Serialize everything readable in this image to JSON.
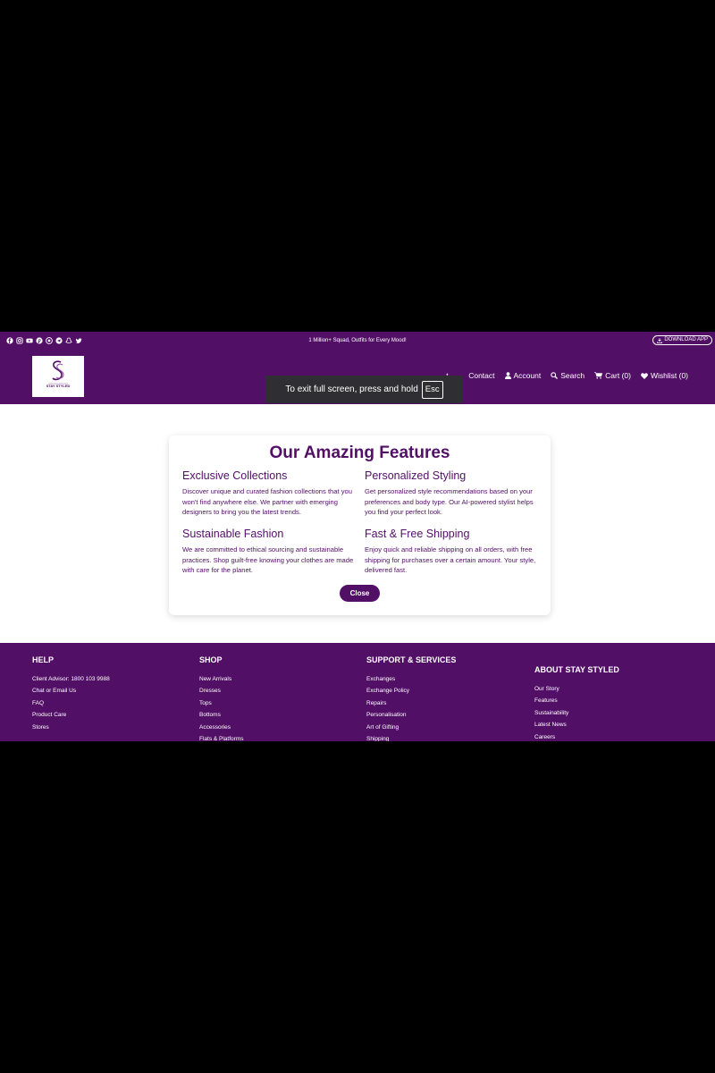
{
  "topbar": {
    "social_icons": [
      "facebook-icon",
      "instagram-icon",
      "youtube-icon",
      "pinterest-icon",
      "whatsapp-icon",
      "telegram-icon",
      "snapchat-icon",
      "twitter-icon"
    ],
    "tagline": "1 Million+ Squad, Outfits for Every Mood!",
    "download_label": "DOWNLOAD APP"
  },
  "header": {
    "logo_text": "STAY STYLED",
    "nav": {
      "partial_label": "t",
      "contact": "Contact",
      "account": "Account",
      "search": "Search",
      "cart": "Cart (0)",
      "wishlist": "Wishlist (0)"
    }
  },
  "toast": {
    "message": "To exit full screen, press and hold",
    "key": "Esc"
  },
  "modal": {
    "title": "Our Amazing Features",
    "features": [
      {
        "title": "Exclusive Collections",
        "text": "Discover unique and curated fashion collections that you won't find anywhere else. We partner with emerging designers to bring you the latest trends."
      },
      {
        "title": "Personalized Styling",
        "text": "Get personalized style recommendations based on your preferences and body type. Our AI-powered stylist helps you find your perfect look."
      },
      {
        "title": "Sustainable Fashion",
        "text": "We are committed to ethical sourcing and sustainable practices. Shop guilt-free knowing your clothes are made with care for the planet."
      },
      {
        "title": "Fast & Free Shipping",
        "text": "Enjoy quick and reliable shipping on all orders, with free shipping for purchases over a certain amount. Your style, delivered fast."
      }
    ],
    "close_label": "Close"
  },
  "footer": {
    "columns": [
      {
        "heading": "HELP",
        "links": [
          "Client Advisor: 1800 103 9988",
          "Chat or Email Us",
          "FAQ",
          "Product Care",
          "Stores"
        ]
      },
      {
        "heading": "SHOP",
        "links": [
          "New Arrivals",
          "Dresses",
          "Tops",
          "Bottoms",
          "Accessories",
          "Flats & Platforms"
        ]
      },
      {
        "heading": "SUPPORT & SERVICES",
        "links": [
          "Exchanges",
          "Exchange Policy",
          "Repairs",
          "Personalisation",
          "Art of Gifting",
          "Shipping"
        ]
      },
      {
        "heading": "ABOUT STAY STYLED",
        "links": [
          "Our Story",
          "Features",
          "Sustainability",
          "Latest News",
          "Careers"
        ]
      }
    ]
  },
  "colors": {
    "brand": "#520f66",
    "toast_bg": "#2f2f33",
    "background": "#000000"
  }
}
